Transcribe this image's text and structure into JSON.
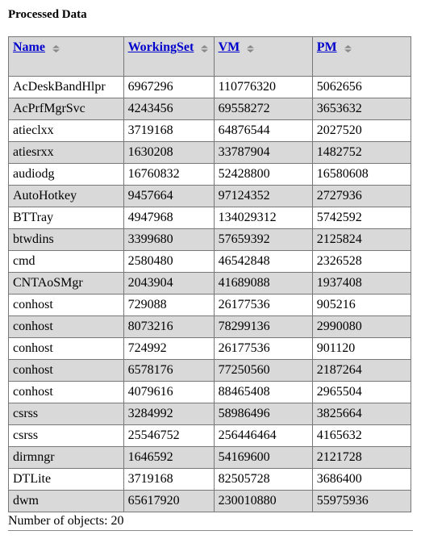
{
  "title": "Processed Data",
  "columns": [
    "Name",
    "WorkingSet",
    "VM",
    "PM"
  ],
  "rows": [
    {
      "name": "AcDeskBandHlpr",
      "ws": "6967296",
      "vm": "110776320",
      "pm": "5062656"
    },
    {
      "name": "AcPrfMgrSvc",
      "ws": "4243456",
      "vm": "69558272",
      "pm": "3653632"
    },
    {
      "name": "atieclxx",
      "ws": "3719168",
      "vm": "64876544",
      "pm": "2027520"
    },
    {
      "name": "atiesrxx",
      "ws": "1630208",
      "vm": "33787904",
      "pm": "1482752"
    },
    {
      "name": "audiodg",
      "ws": "16760832",
      "vm": "52428800",
      "pm": "16580608"
    },
    {
      "name": "AutoHotkey",
      "ws": "9457664",
      "vm": "97124352",
      "pm": "2727936"
    },
    {
      "name": "BTTray",
      "ws": "4947968",
      "vm": "134029312",
      "pm": "5742592"
    },
    {
      "name": "btwdins",
      "ws": "3399680",
      "vm": "57659392",
      "pm": "2125824"
    },
    {
      "name": "cmd",
      "ws": "2580480",
      "vm": "46542848",
      "pm": "2326528"
    },
    {
      "name": "CNTAoSMgr",
      "ws": "2043904",
      "vm": "41689088",
      "pm": "1937408"
    },
    {
      "name": "conhost",
      "ws": "729088",
      "vm": "26177536",
      "pm": "905216"
    },
    {
      "name": "conhost",
      "ws": "8073216",
      "vm": "78299136",
      "pm": "2990080"
    },
    {
      "name": "conhost",
      "ws": "724992",
      "vm": "26177536",
      "pm": "901120"
    },
    {
      "name": "conhost",
      "ws": "6578176",
      "vm": "77250560",
      "pm": "2187264"
    },
    {
      "name": "conhost",
      "ws": "4079616",
      "vm": "88465408",
      "pm": "2965504"
    },
    {
      "name": "csrss",
      "ws": "3284992",
      "vm": "58986496",
      "pm": "3825664"
    },
    {
      "name": "csrss",
      "ws": "25546752",
      "vm": "256446464",
      "pm": "4165632"
    },
    {
      "name": "dirmngr",
      "ws": "1646592",
      "vm": "54169600",
      "pm": "2121728"
    },
    {
      "name": "DTLite",
      "ws": "3719168",
      "vm": "82505728",
      "pm": "3686400"
    },
    {
      "name": "dwm",
      "ws": "65617920",
      "vm": "230010880",
      "pm": "55975936"
    }
  ],
  "footer": {
    "label": "Number of objects:",
    "count": "20"
  }
}
